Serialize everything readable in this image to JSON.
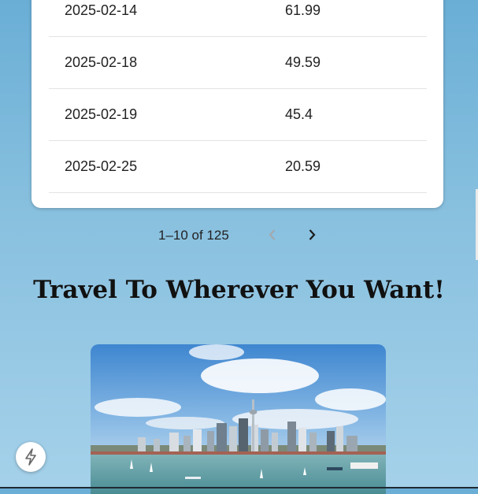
{
  "table": {
    "rows": [
      {
        "date": "2025-02-14",
        "value": "61.99"
      },
      {
        "date": "2025-02-18",
        "value": "49.59"
      },
      {
        "date": "2025-02-19",
        "value": "45.4"
      },
      {
        "date": "2025-02-25",
        "value": "20.59"
      }
    ]
  },
  "pagination": {
    "label": "1–10 of 125",
    "prev_icon": "chevron-left-icon",
    "next_icon": "chevron-right-icon"
  },
  "travel": {
    "heading": "Travel To Wherever You Want!",
    "image": "city-skyline-harbor-photo"
  },
  "fab": {
    "icon": "lightning-bolt-icon"
  },
  "colors": {
    "background_top": "#6aaed6",
    "background_bottom": "#a5d1ea",
    "card": "#ffffff",
    "text": "#222222"
  }
}
